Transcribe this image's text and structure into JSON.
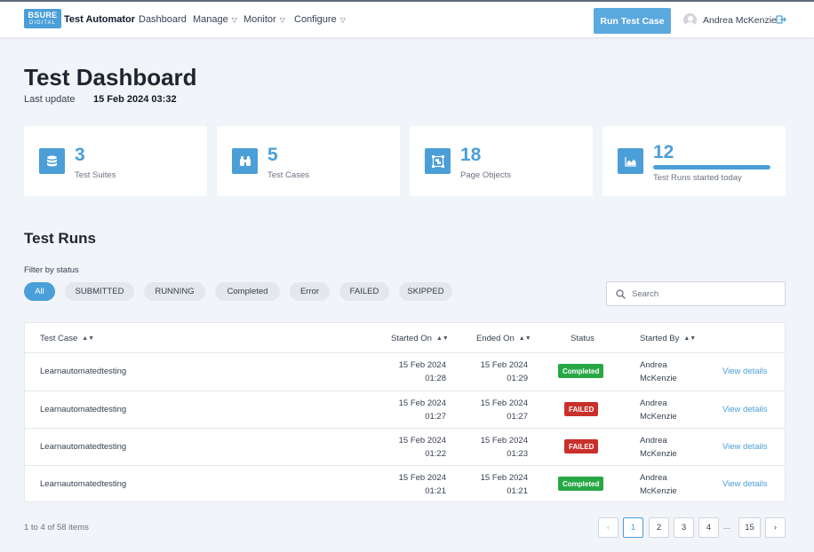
{
  "brand": {
    "logo_top": "BSURE",
    "logo_bottom": "DIGITAL",
    "app_name": "Test Automator"
  },
  "nav": {
    "dashboard": "Dashboard",
    "manage": "Manage",
    "monitor": "Monitor",
    "configure": "Configure"
  },
  "header_actions": {
    "run_test_case": "Run Test Case",
    "user_name": "Andrea McKenzie"
  },
  "page": {
    "title": "Test Dashboard",
    "last_update_label": "Last update",
    "last_update_value": "15 Feb 2024 03:32"
  },
  "stats": {
    "suites": {
      "value": "3",
      "label": "Test Suites",
      "icon": "database-icon"
    },
    "cases": {
      "value": "5",
      "label": "Test Cases",
      "icon": "binoculars-icon"
    },
    "objects": {
      "value": "18",
      "label": "Page Objects",
      "icon": "object-group-icon"
    },
    "runs": {
      "value": "12",
      "label": "Test Runs started today",
      "icon": "area-chart-icon",
      "progress": 1.0
    }
  },
  "test_runs": {
    "title": "Test Runs",
    "filter_label": "Filter by status",
    "filters": {
      "all": "All",
      "submitted": "SUBMITTED",
      "running": "RUNNING",
      "completed": "Completed",
      "error": "Error",
      "failed": "FAILED",
      "skipped": "SKIPPED"
    },
    "search_placeholder": "Search",
    "columns": {
      "test_case": "Test Case",
      "started_on": "Started On",
      "ended_on": "Ended On",
      "status": "Status",
      "started_by": "Started By"
    },
    "rows": [
      {
        "test_case": "Learnautomatedtesting",
        "started_date": "15 Feb 2024",
        "started_time": "01:28",
        "ended_date": "15 Feb 2024",
        "ended_time": "01:29",
        "status": "Completed",
        "by_first": "Andrea",
        "by_last": "McKenzie",
        "action": "View details"
      },
      {
        "test_case": "Learnautomatedtesting",
        "started_date": "15 Feb 2024",
        "started_time": "01:27",
        "ended_date": "15 Feb 2024",
        "ended_time": "01:27",
        "status": "FAILED",
        "by_first": "Andrea",
        "by_last": "McKenzie",
        "action": "View details"
      },
      {
        "test_case": "Learnautomatedtesting",
        "started_date": "15 Feb 2024",
        "started_time": "01:22",
        "ended_date": "15 Feb 2024",
        "ended_time": "01:23",
        "status": "FAILED",
        "by_first": "Andrea",
        "by_last": "McKenzie",
        "action": "View details"
      },
      {
        "test_case": "Learnautomatedtesting",
        "started_date": "15 Feb 2024",
        "started_time": "01:21",
        "ended_date": "15 Feb 2024",
        "ended_time": "01:21",
        "status": "Completed",
        "by_first": "Andrea",
        "by_last": "McKenzie",
        "action": "View details"
      }
    ]
  },
  "pagination": {
    "summary": "1 to 4 of 58 items",
    "prev": "‹",
    "pages": {
      "p1": "1",
      "p2": "2",
      "p3": "3",
      "p4": "4",
      "last": "15"
    },
    "ellipsis": "...",
    "next": "›",
    "current": "1"
  },
  "colors": {
    "accent": "#4a9fd8",
    "completed": "#28a745",
    "failed": "#c9302c",
    "background": "#f1f4f8"
  }
}
